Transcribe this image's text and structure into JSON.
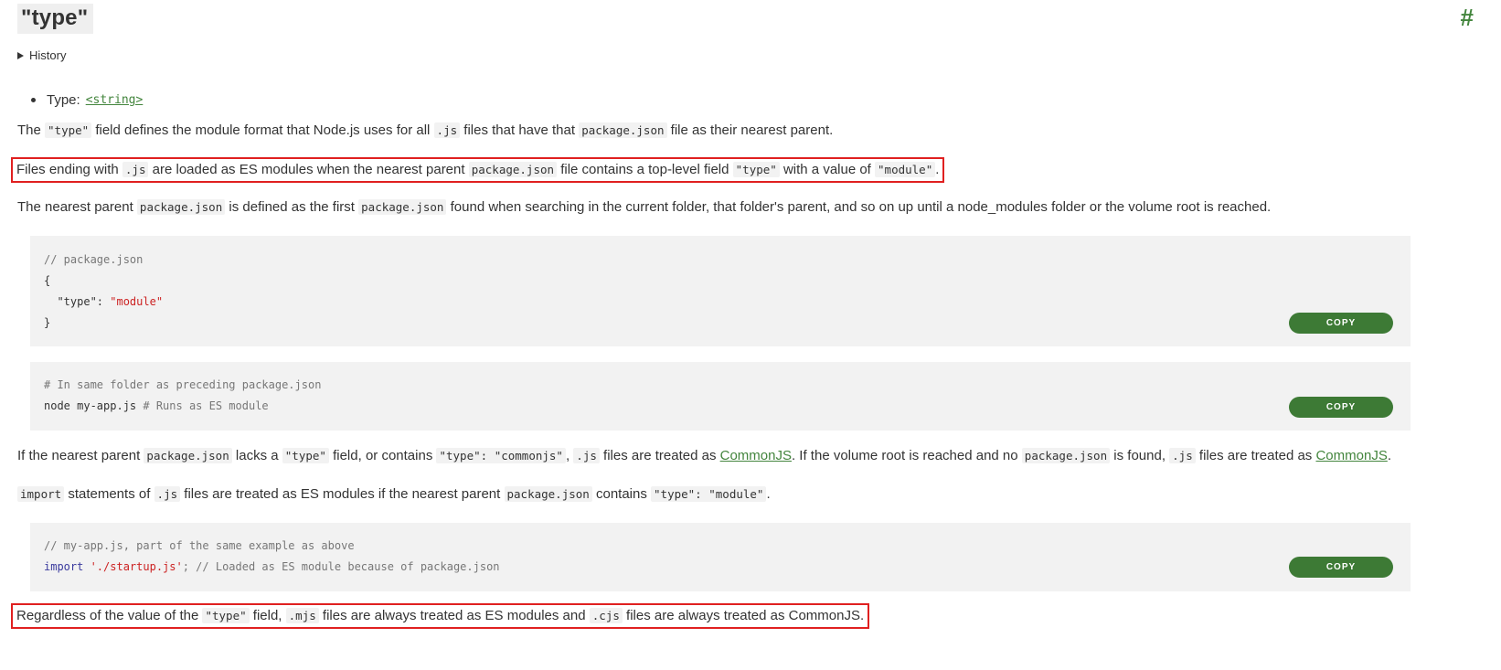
{
  "section": {
    "title": "\"type\"",
    "anchor": "#",
    "history_label": "History"
  },
  "type_line": {
    "label": "Type: ",
    "value": "<string>"
  },
  "p1": {
    "t1": "The ",
    "c1": "\"type\"",
    "t2": " field defines the module format that Node.js uses for all ",
    "c2": ".js",
    "t3": " files that have that ",
    "c3": "package.json",
    "t4": " file as their nearest parent."
  },
  "p2": {
    "t1": "Files ending with ",
    "c1": ".js",
    "t2": " are loaded as ES modules when the nearest parent ",
    "c2": "package.json",
    "t3": " file contains a top-level field ",
    "c3": "\"type\"",
    "t4": " with a value of ",
    "c4": "\"module\"",
    "t5": "."
  },
  "p3": {
    "t1": "The nearest parent ",
    "c1": "package.json",
    "t2": " is defined as the first ",
    "c2": "package.json",
    "t3": " found when searching in the current folder, that folder's parent, and so on up until a node_modules folder or the volume root is reached."
  },
  "code1": {
    "comment": "// package.json",
    "open": "{",
    "key": "  \"type\"",
    "colon": ": ",
    "value": "\"module\"",
    "close": "}"
  },
  "code2": {
    "comment": "# In same folder as preceding package.json",
    "cmd": "node my-app.js",
    "trail": " # Runs as ES module"
  },
  "p4": {
    "t1": "If the nearest parent ",
    "c1": "package.json",
    "t2": " lacks a ",
    "c2": "\"type\"",
    "t3": " field, or contains ",
    "c3": "\"type\": \"commonjs\"",
    "t4": ", ",
    "c4": ".js",
    "t5": " files are treated as ",
    "l1": "CommonJS",
    "t6": ". If the volume root is reached and no ",
    "c5": "package.json",
    "t7": " is found, ",
    "c6": ".js",
    "t8": " files are treated as ",
    "l2": "CommonJS",
    "t9": "."
  },
  "p5": {
    "c1": "import",
    "t1": " statements of ",
    "c2": ".js",
    "t2": " files are treated as ES modules if the nearest parent ",
    "c3": "package.json",
    "t3": " contains ",
    "c4": "\"type\": \"module\"",
    "t4": "."
  },
  "code3": {
    "comment": "// my-app.js, part of the same example as above",
    "kw": "import",
    "str": " './startup.js'",
    "rest": "; // Loaded as ES module because of package.json"
  },
  "p6": {
    "t1": "Regardless of the value of the ",
    "c1": "\"type\"",
    "t2": " field, ",
    "c2": ".mjs",
    "t3": " files are always treated as ES modules and ",
    "c3": ".cjs",
    "t4": " files are always treated as CommonJS."
  },
  "copy_label": "COPY",
  "colors": {
    "accent": "#43853d",
    "button": "#3d7a35",
    "highlight_border": "#e02020",
    "code_bg": "#f2f2f2"
  }
}
